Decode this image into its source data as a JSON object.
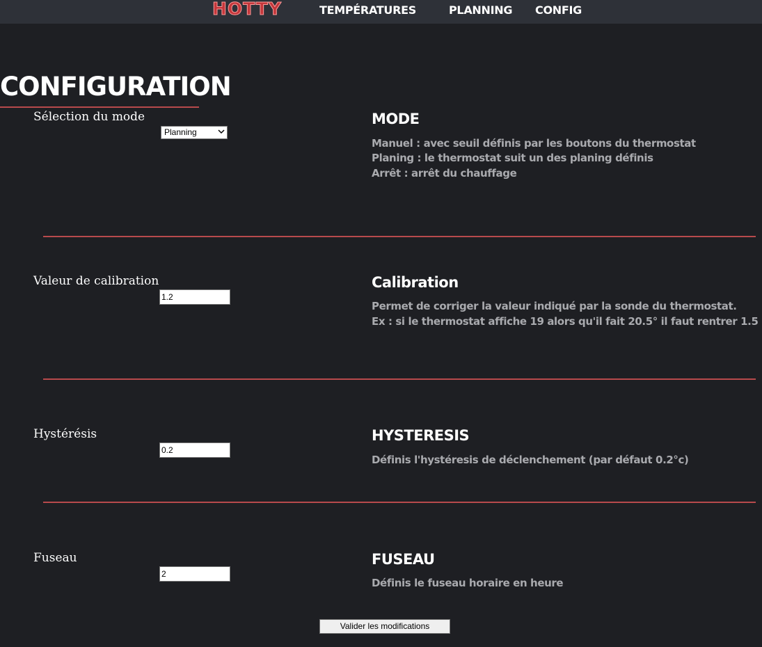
{
  "nav": {
    "logo": "HOTTY",
    "links": [
      "TEMPÉRATURES",
      "PLANNING",
      "CONFIG"
    ]
  },
  "page": {
    "title": "CONFIGURATION"
  },
  "mode": {
    "label": "Sélection du mode",
    "selected": "Planning",
    "heading": "MODE",
    "lines": [
      "Manuel : avec seuil définis par les boutons du thermostat",
      "Planing : le thermostat suit un des planing définis",
      "Arrêt : arrêt du chauffage"
    ]
  },
  "calibration": {
    "label": "Valeur de calibration",
    "value": "1.2",
    "heading": "Calibration",
    "lines": [
      "Permet de corriger la valeur indiqué par la sonde du thermostat.",
      "Ex : si le thermostat affiche 19 alors qu'il fait 20.5° il faut rentrer 1.5"
    ]
  },
  "hysteresis": {
    "label": "Hystérésis",
    "value": "0.2",
    "heading": "HYSTERESIS",
    "lines": [
      "Définis l'hystéresis de déclenchement (par défaut 0.2°c)"
    ]
  },
  "timezone": {
    "label": "Fuseau",
    "value": "2",
    "heading": "FUSEAU",
    "lines": [
      "Définis le fuseau horaire en heure"
    ]
  },
  "submit_label": "Valider les modifications",
  "colors": {
    "background": "#1e1f23",
    "navbar": "#2e3138",
    "accent": "#b84a4c",
    "logo": "#c4373b",
    "desc_text": "#a9aaae"
  }
}
